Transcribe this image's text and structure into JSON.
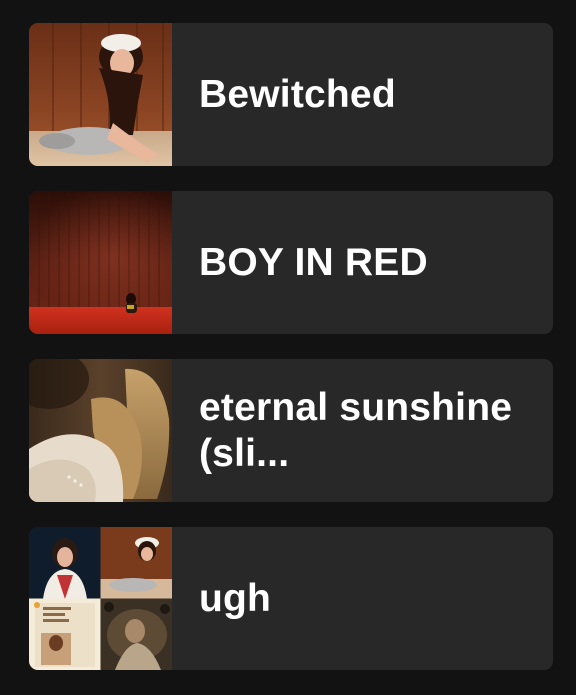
{
  "playlists": [
    {
      "title": "Bewitched",
      "art_icon": "album-cover-bewitched"
    },
    {
      "title": "BOY IN RED",
      "art_icon": "album-cover-boy-in-red"
    },
    {
      "title": "eternal sunshine (sli...",
      "art_icon": "album-cover-eternal-sunshine"
    },
    {
      "title": "ugh",
      "art_icon": "playlist-mosaic-cover"
    }
  ],
  "colors": {
    "background": "#121212",
    "card": "#282828",
    "text": "#ffffff"
  }
}
